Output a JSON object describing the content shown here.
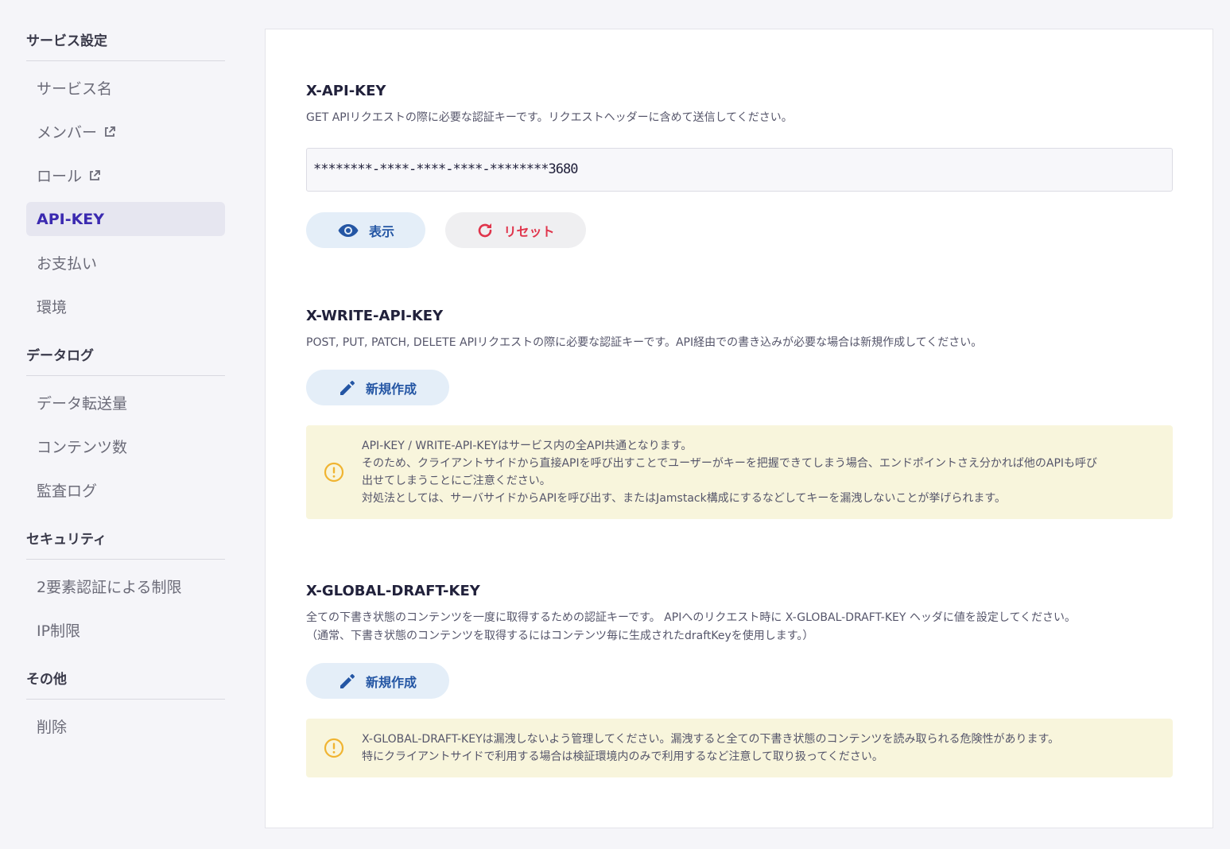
{
  "sidebar": {
    "sections": [
      {
        "title": "サービス設定",
        "items": [
          "サービス名",
          "メンバー",
          "ロール",
          "API-KEY",
          "お支払い",
          "環境"
        ]
      },
      {
        "title": "データログ",
        "items": [
          "データ転送量",
          "コンテンツ数",
          "監査ログ"
        ]
      },
      {
        "title": "セキュリティ",
        "items": [
          "2要素認証による制限",
          "IP制限"
        ]
      },
      {
        "title": "その他",
        "items": [
          "削除"
        ]
      }
    ],
    "active_item": "API-KEY"
  },
  "api_key": {
    "title": "X-API-KEY",
    "description": "GET APIリクエストの際に必要な認証キーです。リクエストヘッダーに含めて送信してください。",
    "masked_value": "********-****-****-****-********3680",
    "show_label": "表示",
    "reset_label": "リセット"
  },
  "write_api_key": {
    "title": "X-WRITE-API-KEY",
    "description": "POST, PUT, PATCH, DELETE APIリクエストの際に必要な認証キーです。API経由での書き込みが必要な場合は新規作成してください。",
    "create_label": "新規作成",
    "notice": [
      "API-KEY / WRITE-API-KEYはサービス内の全API共通となります。",
      "そのため、クライアントサイドから直接APIを呼び出すことでユーザーがキーを把握できてしまう場合、エンドポイントさえ分かれば他のAPIも呼び",
      "出せてしまうことにご注意ください。",
      "対処法としては、サーバサイドからAPIを呼び出す、またはJamstack構成にするなどしてキーを漏洩しないことが挙げられます。"
    ]
  },
  "global_draft_key": {
    "title": "X-GLOBAL-DRAFT-KEY",
    "description": [
      "全ての下書き状態のコンテンツを一度に取得するための認証キーです。 APIへのリクエスト時に X-GLOBAL-DRAFT-KEY ヘッダに値を設定してください。",
      "（通常、下書き状態のコンテンツを取得するにはコンテンツ毎に生成されたdraftKeyを使用します。）"
    ],
    "create_label": "新規作成",
    "notice": [
      "X-GLOBAL-DRAFT-KEYは漏洩しないよう管理してください。漏洩すると全ての下書き状態のコンテンツを読み取られる危険性があります。",
      "特にクライアントサイドで利用する場合は検証環境内のみで利用するなど注意して取り扱ってください。"
    ]
  },
  "colors": {
    "accent": "#3b2ab0",
    "button_blue_bg": "#e4eef8",
    "button_blue_text": "#2456a4",
    "reset_red": "#e0344b",
    "notice_bg": "#f8f5dc",
    "warning_icon": "#f0b431"
  }
}
